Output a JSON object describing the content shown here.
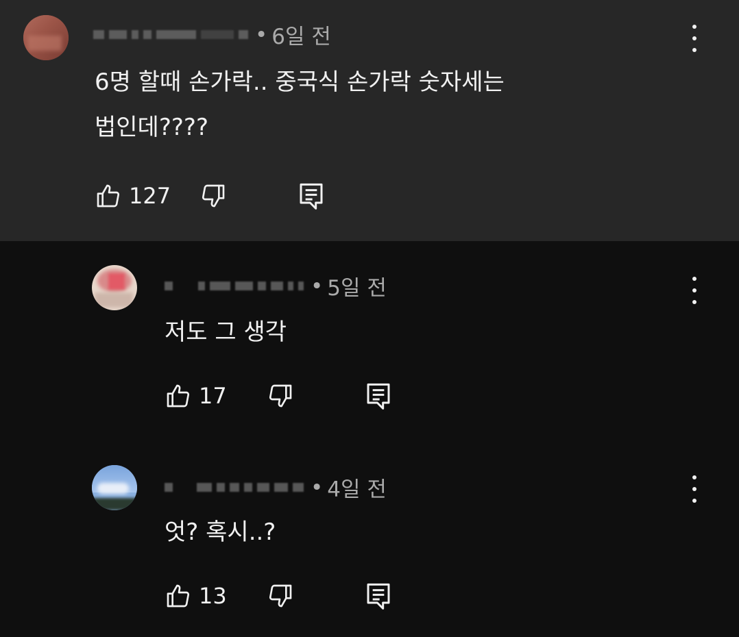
{
  "comments": [
    {
      "time": "6일 전",
      "text_lines": [
        "6명 할때 손가락.. 중국식 손가락 숫자세는",
        "법인데????"
      ],
      "likes": "127",
      "avatar_icon": "avatar"
    },
    {
      "time": "5일 전",
      "text_lines": [
        "저도 그 생각"
      ],
      "likes": "17",
      "avatar_icon": "avatar"
    },
    {
      "time": "4일 전",
      "text_lines": [
        "엇? 혹시..?"
      ],
      "likes": "13",
      "avatar_icon": "avatar"
    }
  ],
  "icons": {
    "like": "thumbs-up-icon",
    "dislike": "thumbs-down-icon",
    "reply": "reply-icon",
    "more": "more-vert-icon"
  },
  "colors": {
    "top_background": "#272727",
    "page_background": "#0f0f0f",
    "text": "#f1f1f1",
    "meta_text": "#aaaaaa"
  }
}
